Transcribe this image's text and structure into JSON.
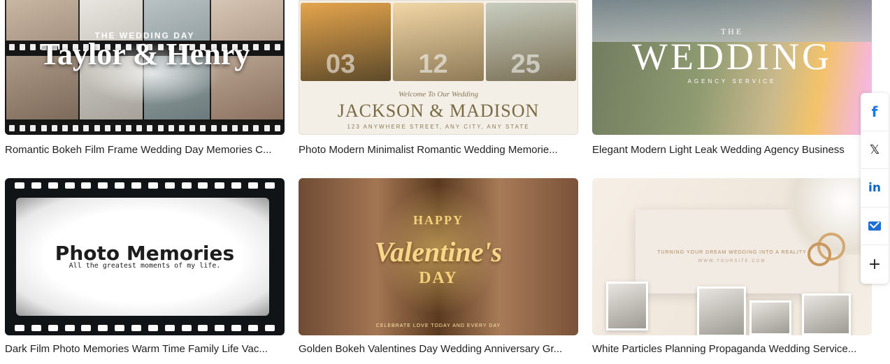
{
  "cards": [
    {
      "caption": "Romantic Bokeh Film Frame Wedding Day Memories C...",
      "thumb": {
        "kicker": "THE WEDDING DAY",
        "names": "Taylor & Henry"
      }
    },
    {
      "caption": "Photo Modern Minimalist Romantic Wedding Memorie...",
      "thumb": {
        "nums": [
          "03",
          "12",
          "25"
        ],
        "welcome": "Welcome To Our Wedding",
        "couple": "JACKSON & MADISON",
        "address": "123 ANYWHERE STREET, ANY CITY, ANY STATE"
      }
    },
    {
      "caption": "Elegant Modern Light Leak Wedding Agency Business",
      "thumb": {
        "the": "THE",
        "big": "WEDDING",
        "sub": "AGENCY SERVICE"
      }
    },
    {
      "caption": "Dark Film Photo Memories Warm Time Family Life Vac...",
      "thumb": {
        "title": "Photo Memories",
        "tag": "All the greatest moments of my life."
      }
    },
    {
      "caption": "Golden Bokeh Valentines Day Wedding Anniversary Gr...",
      "thumb": {
        "happy": "HAPPY",
        "val": "Valentine's",
        "day": "DAY",
        "cele": "CELEBRATE LOVE TODAY AND EVERY DAY"
      }
    },
    {
      "caption": "White Particles Planning Propaganda Wedding Service...",
      "thumb": {
        "tagline": "TURNING YOUR DREAM WEDDING INTO A REALITY",
        "site": "WWW.YOURSITE.COM"
      }
    }
  ],
  "share": {
    "facebook_icon": "f",
    "x_icon": "𝕏",
    "linkedin_icon": "in",
    "more_icon": "+"
  }
}
